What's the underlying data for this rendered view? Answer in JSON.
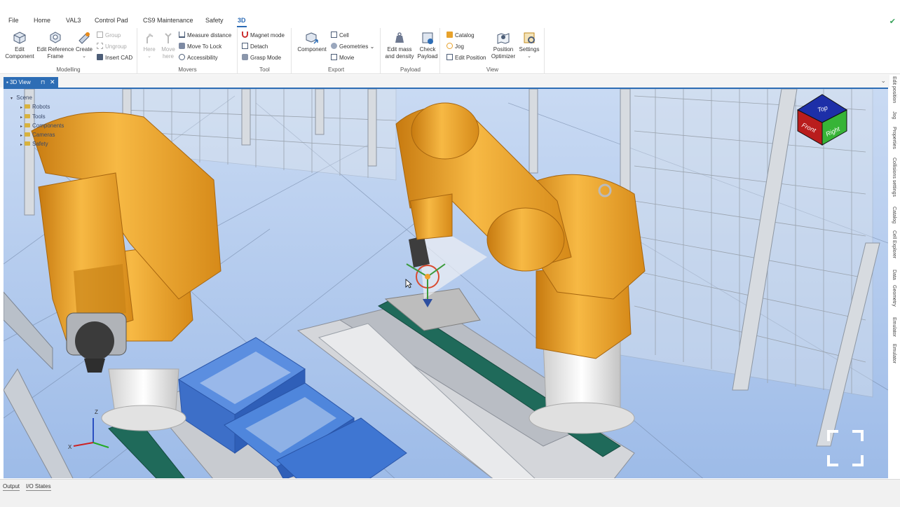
{
  "menu": {
    "tabs": [
      {
        "label": "File"
      },
      {
        "label": "Home"
      },
      {
        "label": "VAL3"
      },
      {
        "label": "Control Pad"
      },
      {
        "label": "CS9 Maintenance"
      },
      {
        "label": "Safety"
      },
      {
        "label": "3D"
      }
    ],
    "active_tab": "3D"
  },
  "ribbon": {
    "modelling": {
      "label": "Modelling",
      "edit_component": "Edit\nComponent",
      "edit_reference_frame": "Edit Reference\nFrame",
      "create": "Create",
      "group": "Group",
      "ungroup": "Ungroup",
      "insert_cad": "Insert CAD"
    },
    "movers": {
      "label": "Movers",
      "here": "Here",
      "move_here": "Move\nhere",
      "measure_distance": "Measure distance",
      "move_to_lock": "Move To Lock",
      "accessibility": "Accessibility"
    },
    "tool": {
      "label": "Tool",
      "magnet_mode": "Magnet mode",
      "detach": "Detach",
      "grasp_mode": "Grasp Mode"
    },
    "export": {
      "label": "Export",
      "component": "Component",
      "cell": "Cell",
      "geometries": "Geometries",
      "movie": "Movie"
    },
    "payload": {
      "label": "Payload",
      "edit_mass": "Edit mass\nand density",
      "check_payload": "Check\nPayload"
    },
    "view": {
      "label": "View",
      "catalog": "Catalog",
      "jog": "Jog",
      "edit_position": "Edit Position",
      "position_optimizer": "Position\nOptimizer",
      "settings": "Settings"
    }
  },
  "document_tab": {
    "label": "3D View"
  },
  "scene_tree": {
    "root": "Scene",
    "children": [
      "Robots",
      "Tools",
      "Components",
      "Cameras",
      "Safety"
    ]
  },
  "view_cube": {
    "top": "Top",
    "front": "Front",
    "right": "Right"
  },
  "axis_labels": {
    "x": "X",
    "z": "Z"
  },
  "right_rail": [
    "Edit position",
    "Jog",
    "Properties",
    "Collisions settings",
    "Catalog",
    "Cell Explorer",
    "Data",
    "Geometry",
    "Emulator",
    "Emulator"
  ],
  "bottom_tabs": [
    "Output",
    "I/O States"
  ],
  "colors": {
    "accent": "#2d6db5",
    "robot": "#e8a22b",
    "floor": "#b6cdef",
    "crate": "#3d77d6"
  }
}
